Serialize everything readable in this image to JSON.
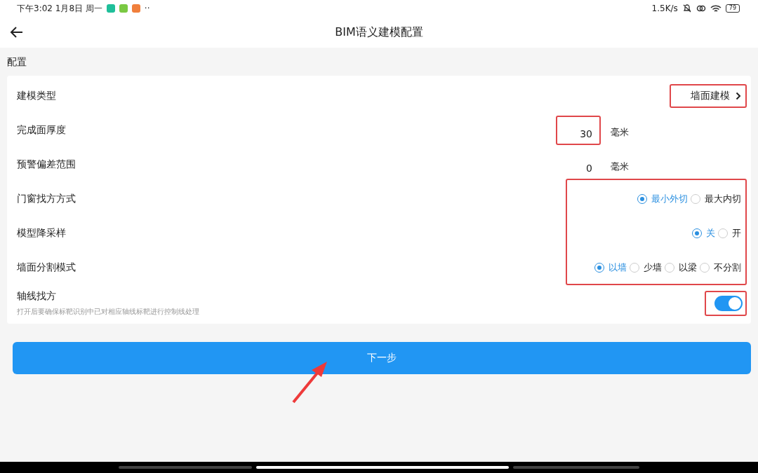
{
  "status_bar": {
    "time": "下午3:02 1月8日 周一",
    "more": "··",
    "speed": "1.5K/s",
    "battery": "79"
  },
  "header": {
    "title": "BIM语义建模配置"
  },
  "section": {
    "title": "配置"
  },
  "rows": [
    {
      "kind": "select",
      "label": "建模类型",
      "value": "墙面建模",
      "highlighted": true
    },
    {
      "kind": "number",
      "label": "完成面厚度",
      "value": "30",
      "unit": "毫米",
      "highlighted": true
    },
    {
      "kind": "number",
      "label": "预警偏差范围",
      "value": "0",
      "unit": "毫米",
      "highlighted": false
    }
  ],
  "radio_group": {
    "highlighted": true,
    "rows": [
      {
        "label": "门窗找方方式",
        "options": [
          {
            "label": "最小外切",
            "selected": true
          },
          {
            "label": "最大内切",
            "selected": false
          }
        ]
      },
      {
        "label": "模型降采样",
        "options": [
          {
            "label": "关",
            "selected": true
          },
          {
            "label": "开",
            "selected": false
          }
        ]
      },
      {
        "label": "墙面分割模式",
        "options": [
          {
            "label": "以墙",
            "selected": true
          },
          {
            "label": "少墙",
            "selected": false
          },
          {
            "label": "以梁",
            "selected": false
          },
          {
            "label": "不分割",
            "selected": false
          }
        ]
      }
    ]
  },
  "toggle_row": {
    "label": "轴线找方",
    "hint": "打开后要确保标靶识别中已对相应轴线标靶进行控制线处理",
    "on": true,
    "highlighted": true
  },
  "next_button": {
    "label": "下一步",
    "annotated": true
  }
}
